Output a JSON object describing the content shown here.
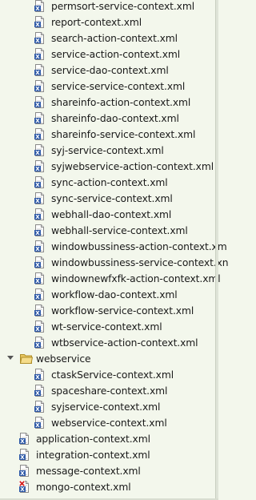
{
  "tree": {
    "items": [
      {
        "label": "permsort-service-context.xml",
        "icon": "xml-file-icon"
      },
      {
        "label": "report-context.xml",
        "icon": "xml-file-icon"
      },
      {
        "label": "search-action-context.xml",
        "icon": "xml-file-icon"
      },
      {
        "label": "service-action-context.xml",
        "icon": "xml-file-icon"
      },
      {
        "label": "service-dao-context.xml",
        "icon": "xml-file-icon"
      },
      {
        "label": "service-service-context.xml",
        "icon": "xml-file-icon"
      },
      {
        "label": "shareinfo-action-context.xml",
        "icon": "xml-file-icon"
      },
      {
        "label": "shareinfo-dao-context.xml",
        "icon": "xml-file-icon"
      },
      {
        "label": "shareinfo-service-context.xml",
        "icon": "xml-file-icon"
      },
      {
        "label": "syj-service-context.xml",
        "icon": "xml-file-icon"
      },
      {
        "label": "syjwebservice-action-context.xml",
        "icon": "xml-file-icon"
      },
      {
        "label": "sync-action-context.xml",
        "icon": "xml-file-icon"
      },
      {
        "label": "sync-service-context.xml",
        "icon": "xml-file-icon"
      },
      {
        "label": "webhall-dao-context.xml",
        "icon": "xml-file-icon"
      },
      {
        "label": "webhall-service-context.xml",
        "icon": "xml-file-icon"
      },
      {
        "label": "windowbussiness-action-context.xm",
        "icon": "xml-file-icon"
      },
      {
        "label": "windowbussiness-service-context.xn",
        "icon": "xml-file-icon"
      },
      {
        "label": "windownewfxfk-action-context.xml",
        "icon": "xml-file-icon"
      },
      {
        "label": "workflow-dao-context.xml",
        "icon": "xml-file-icon"
      },
      {
        "label": "workflow-service-context.xml",
        "icon": "xml-file-icon"
      },
      {
        "label": "wt-service-context.xml",
        "icon": "xml-file-icon"
      },
      {
        "label": "wtbservice-action-context.xml",
        "icon": "xml-file-icon"
      }
    ],
    "folder": {
      "label": "webservice",
      "icon": "folder-icon",
      "expanded": true
    },
    "folder_items": [
      {
        "label": "ctaskService-context.xml",
        "icon": "xml-file-icon"
      },
      {
        "label": "spaceshare-context.xml",
        "icon": "xml-file-icon"
      },
      {
        "label": "syjservice-context.xml",
        "icon": "xml-file-icon"
      },
      {
        "label": "webservice-context.xml",
        "icon": "xml-file-icon"
      }
    ],
    "root_items": [
      {
        "label": "application-context.xml",
        "icon": "xml-file-icon"
      },
      {
        "label": "integration-context.xml",
        "icon": "xml-file-icon"
      },
      {
        "label": "message-context.xml",
        "icon": "xml-file-icon"
      },
      {
        "label": "mongo-context.xml",
        "icon": "xml-file-error-icon"
      }
    ]
  },
  "colors": {
    "background": "#f3f7ec",
    "folder": "#e8c660",
    "xml_badge": "#2f5aa8",
    "error": "#d42020"
  }
}
